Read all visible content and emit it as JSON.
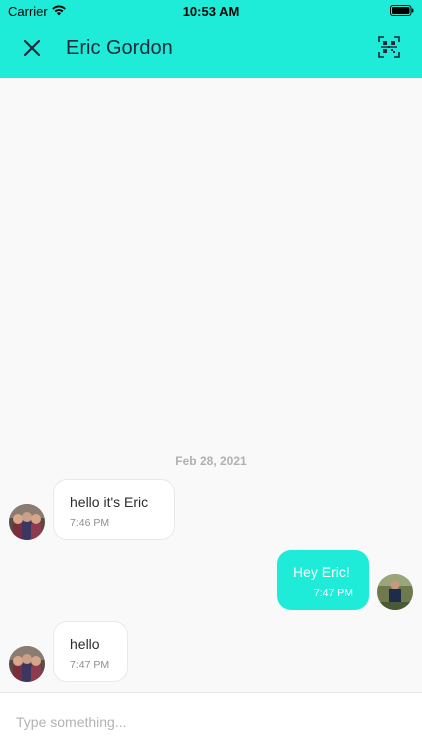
{
  "status_bar": {
    "carrier": "Carrier",
    "time": "10:53 AM"
  },
  "header": {
    "title": "Eric Gordon",
    "accent_color": "#1eecd8",
    "close_icon": "close-icon",
    "qr_icon": "qr-code-scan-icon"
  },
  "chat": {
    "date_separator": "Feb 28, 2021",
    "messages": [
      {
        "direction": "incoming",
        "text": "hello it's Eric",
        "time": "7:46 PM"
      },
      {
        "direction": "outgoing",
        "text": "Hey Eric!",
        "time": "7:47 PM"
      },
      {
        "direction": "incoming",
        "text": "hello",
        "time": "7:47 PM"
      }
    ]
  },
  "composer": {
    "placeholder": "Type something..."
  }
}
